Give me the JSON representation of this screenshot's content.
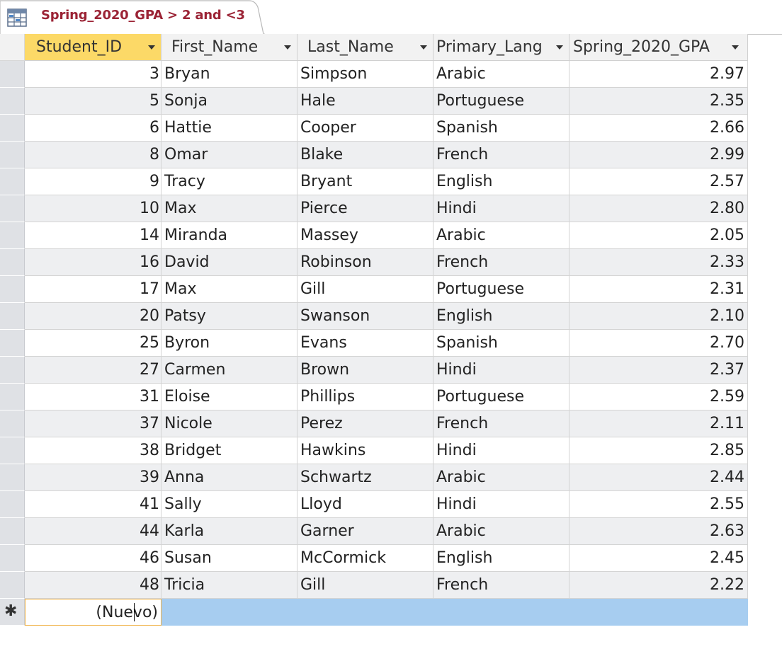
{
  "tab": {
    "title": "Spring_2020_GPA > 2 and <3",
    "icon": "query-datasheet-icon"
  },
  "columns": [
    {
      "key": "Student_ID",
      "label": "Student_ID"
    },
    {
      "key": "First_Name",
      "label": "First_Name"
    },
    {
      "key": "Last_Name",
      "label": "Last_Name"
    },
    {
      "key": "Primary_Lang",
      "label": "Primary_Lang"
    },
    {
      "key": "Spring_2020_GPA",
      "label": "Spring_2020_GPA"
    }
  ],
  "rows": [
    [
      "3",
      "Bryan",
      "Simpson",
      "Arabic",
      "2.97"
    ],
    [
      "5",
      "Sonja",
      "Hale",
      "Portuguese",
      "2.35"
    ],
    [
      "6",
      "Hattie",
      "Cooper",
      "Spanish",
      "2.66"
    ],
    [
      "8",
      "Omar",
      "Blake",
      "French",
      "2.99"
    ],
    [
      "9",
      "Tracy",
      "Bryant",
      "English",
      "2.57"
    ],
    [
      "10",
      "Max",
      "Pierce",
      "Hindi",
      "2.80"
    ],
    [
      "14",
      "Miranda",
      "Massey",
      "Arabic",
      "2.05"
    ],
    [
      "16",
      "David",
      "Robinson",
      "French",
      "2.33"
    ],
    [
      "17",
      "Max",
      "Gill",
      "Portuguese",
      "2.31"
    ],
    [
      "20",
      "Patsy",
      "Swanson",
      "English",
      "2.10"
    ],
    [
      "25",
      "Byron",
      "Evans",
      "Spanish",
      "2.70"
    ],
    [
      "27",
      "Carmen",
      "Brown",
      "Hindi",
      "2.37"
    ],
    [
      "31",
      "Eloise",
      "Phillips",
      "Portuguese",
      "2.59"
    ],
    [
      "37",
      "Nicole",
      "Perez",
      "French",
      "2.11"
    ],
    [
      "38",
      "Bridget",
      "Hawkins",
      "Hindi",
      "2.85"
    ],
    [
      "39",
      "Anna",
      "Schwartz",
      "Arabic",
      "2.44"
    ],
    [
      "41",
      "Sally",
      "Lloyd",
      "Hindi",
      "2.55"
    ],
    [
      "44",
      "Karla",
      "Garner",
      "Arabic",
      "2.63"
    ],
    [
      "46",
      "Susan",
      "McCormick",
      "English",
      "2.45"
    ],
    [
      "48",
      "Tricia",
      "Gill",
      "French",
      "2.22"
    ]
  ],
  "new_record": {
    "label": "(Nuevo)",
    "selector_symbol": "✱"
  },
  "colors": {
    "tab_title": "#9b2335",
    "active_header": "#fcd967",
    "new_row_highlight": "#a7cdf0",
    "alt_row": "#eeeff1"
  }
}
